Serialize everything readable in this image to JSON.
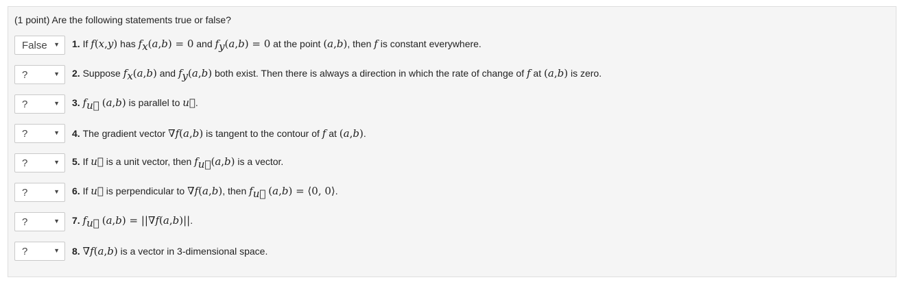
{
  "prompt": "(1 point) Are the following statements true or false?",
  "questions": [
    {
      "answer": "False",
      "number": "1.",
      "html": "If <span class=\"m\">f</span><span class=\"u\">(</span><span class=\"m\">x</span><span class=\"u\">,</span><span class=\"m\">y</span><span class=\"u\">)</span> has <span class=\"m\">f</span><sub class=\"m\">x</sub><span class=\"u\">(</span><span class=\"m\">a</span><span class=\"u\">,</span><span class=\"m\">b</span><span class=\"u\">) = 0</span> and <span class=\"m\">f</span><sub class=\"m\">y</sub><span class=\"u\">(</span><span class=\"m\">a</span><span class=\"u\">,</span><span class=\"m\">b</span><span class=\"u\">) = 0</span> at the point <span class=\"u\">(</span><span class=\"m\">a</span><span class=\"u\">,</span><span class=\"m\">b</span><span class=\"u\">)</span>, then <span class=\"m\">f</span> is constant everywhere."
    },
    {
      "answer": "?",
      "number": "2.",
      "html": "Suppose <span class=\"m\">f</span><sub class=\"m\">x</sub><span class=\"u\">(</span><span class=\"m\">a</span><span class=\"u\">,</span><span class=\"m\">b</span><span class=\"u\">)</span> and <span class=\"m\">f</span><sub class=\"m\">y</sub><span class=\"u\">(</span><span class=\"m\">a</span><span class=\"u\">,</span><span class=\"m\">b</span><span class=\"u\">)</span> both exist. Then there is always a direction in which the rate of change of <span class=\"m\">f</span> at <span class=\"u\">(</span><span class=\"m\">a</span><span class=\"u\">,</span><span class=\"m\">b</span><span class=\"u\">)</span> is zero."
    },
    {
      "answer": "?",
      "number": "3.",
      "html": "<span class=\"m\">f</span><sub class=\"m\">u&#8407;</sub> <span class=\"u\">(</span><span class=\"m\">a</span><span class=\"u\">,</span><span class=\"m\">b</span><span class=\"u\">)</span> is parallel to <span class=\"m\">u&#8407;</span>."
    },
    {
      "answer": "?",
      "number": "4.",
      "html": "The gradient vector <span class=\"u\">&#8711;</span><span class=\"m\">f</span><span class=\"u\">(</span><span class=\"m\">a</span><span class=\"u\">,</span><span class=\"m\">b</span><span class=\"u\">)</span> is tangent to the contour of <span class=\"m\">f</span> at <span class=\"u\">(</span><span class=\"m\">a</span><span class=\"u\">,</span><span class=\"m\">b</span><span class=\"u\">)</span>."
    },
    {
      "answer": "?",
      "number": "5.",
      "html": "If <span class=\"m\">u&#8407;</span> is a unit vector, then <span class=\"m\">f</span><sub class=\"m\">u&#8407;</sub><span class=\"u\">(</span><span class=\"m\">a</span><span class=\"u\">,</span><span class=\"m\">b</span><span class=\"u\">)</span> is a vector."
    },
    {
      "answer": "?",
      "number": "6.",
      "html": "If <span class=\"m\">u&#8407;</span> is perpendicular to <span class=\"u\">&#8711;</span><span class=\"m\">f</span><span class=\"u\">(</span><span class=\"m\">a</span><span class=\"u\">,</span><span class=\"m\">b</span><span class=\"u\">)</span>, then <span class=\"m\">f</span><sub class=\"m\">u&#8407;</sub> <span class=\"u\">(</span><span class=\"m\">a</span><span class=\"u\">,</span><span class=\"m\">b</span><span class=\"u\">) = &#10216;0, 0&#10217;</span>."
    },
    {
      "answer": "?",
      "number": "7.",
      "html": "<span class=\"m\">f</span><sub class=\"m\">u&#8407;</sub> <span class=\"u\">(</span><span class=\"m\">a</span><span class=\"u\">,</span><span class=\"m\">b</span><span class=\"u\">) = ||&#8711;</span><span class=\"m\">f</span><span class=\"u\">(</span><span class=\"m\">a</span><span class=\"u\">,</span><span class=\"m\">b</span><span class=\"u\">)||</span>."
    },
    {
      "answer": "?",
      "number": "8.",
      "html": "<span class=\"u\">&#8711;</span><span class=\"m\">f</span><span class=\"u\">(</span><span class=\"m\">a</span><span class=\"u\">,</span><span class=\"m\">b</span><span class=\"u\">)</span> is a vector in 3-dimensional space."
    }
  ],
  "icons": {
    "dropdown": "triangle-down"
  }
}
